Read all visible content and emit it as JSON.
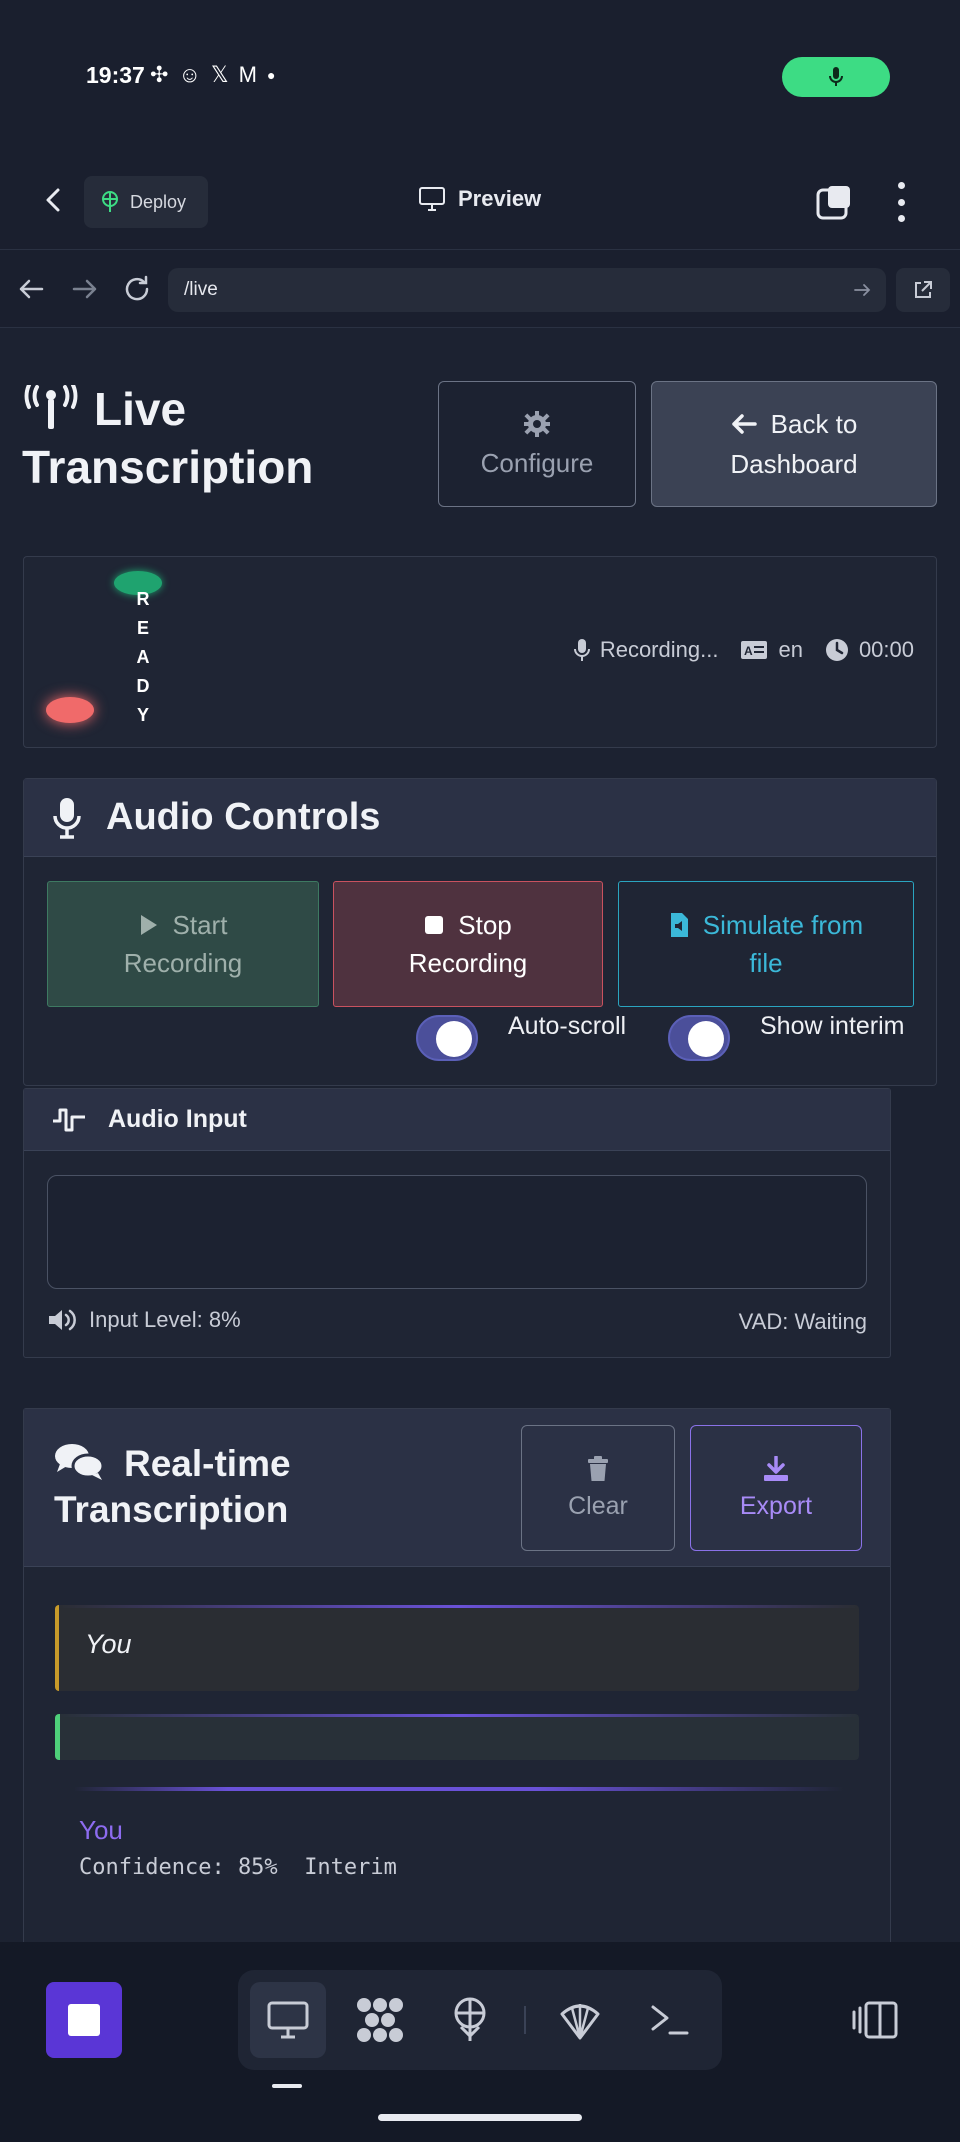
{
  "status_bar": {
    "time": "19:37",
    "notification_icons": [
      "slack-icon",
      "snapchat-icon",
      "x-icon",
      "gmail-icon",
      "dot-icon"
    ],
    "mic_indicator": "mic-active-icon"
  },
  "app_header": {
    "deploy_label": "Deploy",
    "preview_label": "Preview"
  },
  "browser": {
    "url": "/live"
  },
  "page": {
    "title_line1": "Live",
    "title_line2": "Transcription",
    "configure_label": "Configure",
    "back_line1": "Back to",
    "back_line2": "Dashboard"
  },
  "status": {
    "ready_text": "READY",
    "recording_label": "Recording...",
    "language": "en",
    "timer": "00:00"
  },
  "audio_controls": {
    "title": "Audio Controls",
    "start_line1": "Start",
    "start_line2": "Recording",
    "stop_line1": "Stop",
    "stop_line2": "Recording",
    "simulate_line1": "Simulate from",
    "simulate_line2": "file",
    "autoscroll_label": "Auto-scroll",
    "autoscroll_on": true,
    "interim_label": "Show interim",
    "interim_on": true
  },
  "audio_input": {
    "title": "Audio Input",
    "level_label": "Input Level: 8%",
    "level_value": 8,
    "vad_label": "VAD: Waiting"
  },
  "transcription": {
    "title_line1": "Real-time",
    "title_line2": "Transcription",
    "clear_label": "Clear",
    "export_label": "Export",
    "segment1_speaker": "You",
    "speaker_label": "You",
    "confidence_label": "Confidence: 85%",
    "interim_tag": "Interim"
  },
  "colors": {
    "background": "#1c2231",
    "accent_purple": "#5a36d6",
    "start_green": "#2f4a46",
    "stop_red": "#c9525f",
    "simulate_cyan": "#3bb8d8",
    "export_violet": "#a88bf7",
    "ready_green": "#1fa36f",
    "recording_red": "#f06a6a"
  }
}
